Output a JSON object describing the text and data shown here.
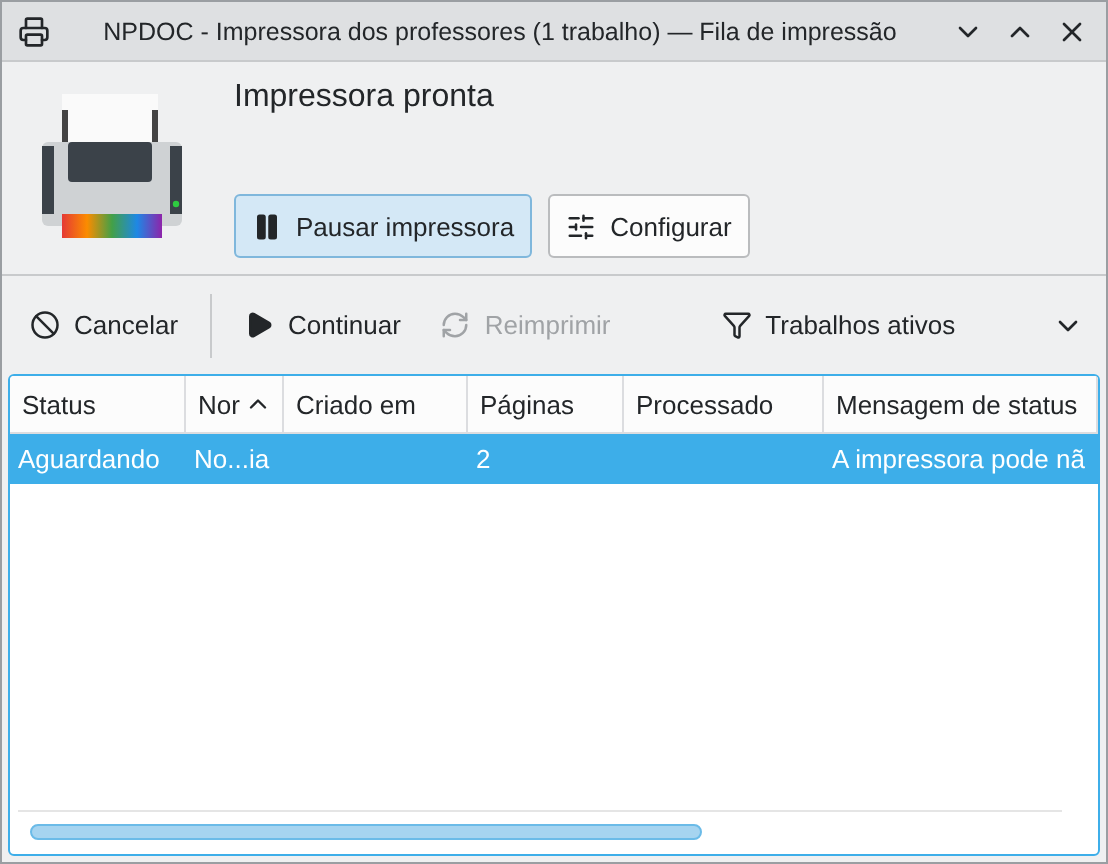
{
  "window": {
    "title": "NPDOC - Impressora dos professores (1 trabalho) — Fila de impressão"
  },
  "printer": {
    "status": "Impressora pronta",
    "buttons": [
      {
        "kind": "pause",
        "label": "Pausar impressora",
        "pressed": true
      },
      {
        "kind": "configure",
        "label": "Configurar",
        "pressed": false
      }
    ]
  },
  "toolbar": {
    "actions": [
      {
        "kind": "cancel",
        "label": "Cancelar",
        "disabled": false
      },
      {
        "kind": "continue",
        "label": "Continuar",
        "disabled": false
      },
      {
        "kind": "reprint",
        "label": "Reimprimir",
        "disabled": true
      }
    ],
    "filter": {
      "label": "Trabalhos ativos"
    }
  },
  "table": {
    "columns": [
      {
        "label": "Status",
        "sorted": false
      },
      {
        "label": "Nor",
        "sorted": true
      },
      {
        "label": "Criado em",
        "sorted": false
      },
      {
        "label": "Páginas",
        "sorted": false
      },
      {
        "label": "Processado",
        "sorted": false
      },
      {
        "label": "Mensagem de status",
        "sorted": false
      }
    ],
    "rows": [
      {
        "selected": true,
        "cells": [
          "Aguardando",
          "No...ia",
          "",
          "2",
          "",
          "A impressora pode nã"
        ]
      }
    ]
  }
}
